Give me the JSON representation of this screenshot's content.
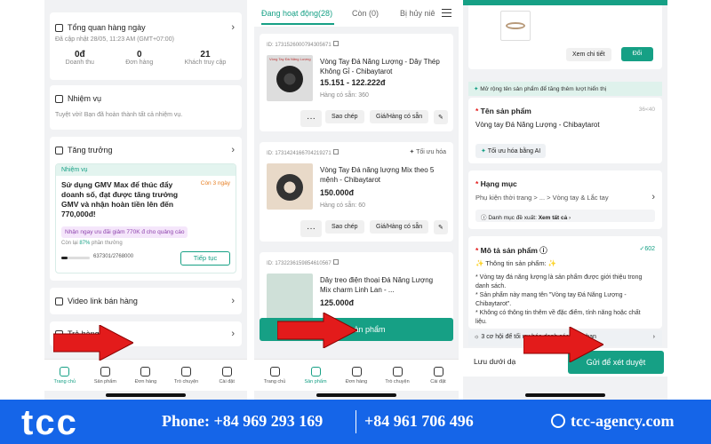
{
  "left_phone": {
    "overview": {
      "title": "Tổng quan hàng ngày",
      "updated": "Đã cập nhật 28/05, 11:23 AM (GMT+07:00)",
      "stats": [
        {
          "value": "0đ",
          "label": "Doanh thu"
        },
        {
          "value": "0",
          "label": "Đơn hàng"
        },
        {
          "value": "21",
          "label": "Khách truy cập"
        }
      ]
    },
    "tasks": {
      "title": "Nhiệm vụ",
      "desc": "Tuyệt vời! Bạn đã hoàn thành tất cả nhiệm vụ."
    },
    "growth": {
      "title": "Tăng trưởng",
      "badge": "Nhiệm vụ",
      "days_left": "Còn 3 ngày",
      "headline": "Sử dụng GMV Max để thúc đẩy doanh số, đạt được tăng trưởng GMV và nhận  hoàn tiền lên đến 770,000đ!",
      "promo": "Nhận ngay ưu đãi giảm 770K đ cho quảng cáo",
      "remaining_pre": "Còn lại ",
      "remaining_pct": "87%",
      "remaining_post": " phần thưởng",
      "progress_text": "637301/2768000",
      "progress_fraction": 0.23,
      "continue": "Tiếp tục"
    },
    "video": {
      "title": "Video link bán hàng"
    },
    "returns": {
      "title": "Trả hàng"
    },
    "tabs": [
      "Trang chủ",
      "Sản phẩm",
      "Đơn hàng",
      "Trò chuyện",
      "Cài đặt"
    ]
  },
  "mid_phone": {
    "tabs": {
      "active": "Đang hoạt động(28)",
      "t2": "Còn (0)",
      "t3": "Bị hủy niê"
    },
    "products": [
      {
        "id": "ID: 1731526000794305671",
        "name": "Vòng Tay Đá Năng Lượng - Dây Thép Không Gỉ - Chibaytarot",
        "price": "15.151 - 122.222đ",
        "stock": "Hàng có sẵn: 360",
        "action1": "Sao chép",
        "action2": "Giá/Hàng có sẵn",
        "optimize": ""
      },
      {
        "id": "ID: 1731424166704219271",
        "name": "Vòng Tay Đá năng lượng Mix theo 5 mệnh - Chibaytarot",
        "price": "150.000đ",
        "stock": "Hàng có sẵn: 60",
        "action1": "Sao chép",
        "action2": "Giá/Hàng có sẵn",
        "optimize": "Tối ưu hóa"
      },
      {
        "id": "ID: 1732236159854610567",
        "name": "Dây treo điện thoại Đá Năng Lượng Mix charm Linh Lan - ...",
        "price": "125.000đ",
        "stock": "",
        "action1": "",
        "action2": "",
        "optimize": ""
      }
    ],
    "add_product": "Thêm sản phẩm",
    "thumb_caption": "Vòng Tay Đá Năng Lượng",
    "tabbar": [
      "Trang chủ",
      "Sản phẩm",
      "Đơn hàng",
      "Trò chuyện",
      "Cài đặt"
    ]
  },
  "right_phone": {
    "view_detail": "Xem chi tiết",
    "change": "Đổi",
    "banner": "Mở rộng tên sản phẩm để tăng thêm lượt hiển thị",
    "name_label": "Tên sản phẩm",
    "name_count": "36<40",
    "name_value": "Vòng tay Đá Năng Lượng - Chibaytarot",
    "ai_button": "Tối ưu hóa bằng AI",
    "category_label": "Hạng mục",
    "category_value": "Phụ kiện thời trang > ... > Vòng tay & Lắc tay",
    "suggest_pre": "Danh mục đề xuất: ",
    "suggest_link": "Xem tất cả",
    "desc_label": "Mô tả sản phẩm",
    "desc_count": "602",
    "desc_heading": "✨ Thông tin sản phẩm: ✨",
    "desc_lines": [
      "* Vòng tay đá năng lượng là sản phẩm được giới thiệu trong danh sách.",
      "* Sản phẩm này mang tên \"Vòng tay Đá Năng Lượng - Chibaytarot\".",
      "* Không có thông tin thêm về đặc điểm, tính năng hoặc chất liệu."
    ],
    "opportunity": "3 cơ hội để tối ưu hóa danh sách của bạn",
    "save_draft": "Lưu dưới dạ",
    "submit": "Gửi để xét duyệt"
  },
  "footer": {
    "logo": "tcc",
    "phone_label": "Phone: +84 969 293 169",
    "phone2": "+84 961 706 496",
    "website": "tcc-agency.com"
  },
  "colors": {
    "accent": "#16a085",
    "arrow": "#e31b1b",
    "footer": "#1565e8"
  }
}
